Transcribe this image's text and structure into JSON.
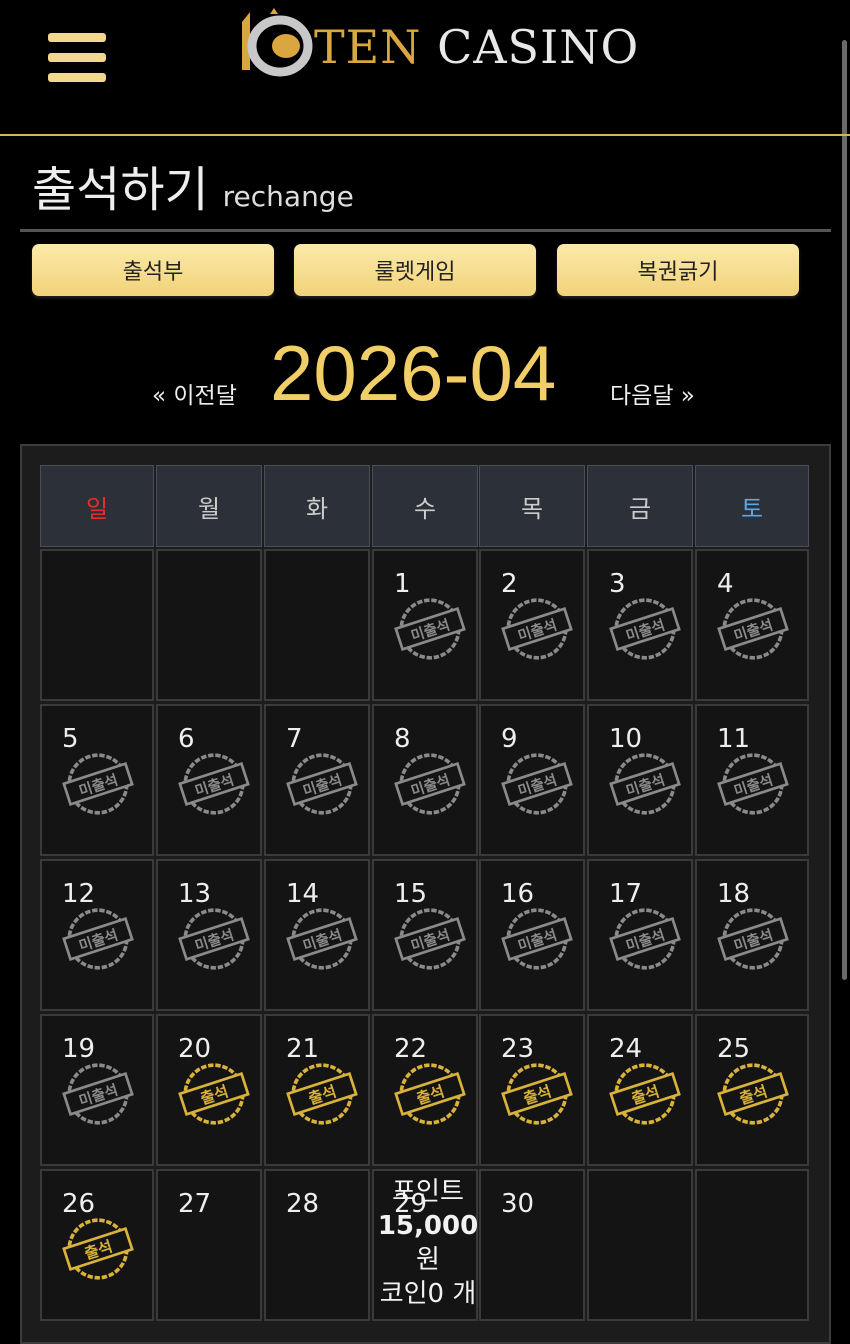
{
  "header": {
    "brand_ten": "TEN",
    "brand_casino": "CASINO",
    "menu_icon": "hamburger-menu-icon",
    "colors": {
      "gold": "#f1ce68",
      "line": "#d9b25a"
    }
  },
  "page": {
    "title": "출석하기",
    "subtitle": "rechange"
  },
  "tabs": [
    {
      "label": "출석부"
    },
    {
      "label": "룰렛게임"
    },
    {
      "label": "복권긁기"
    }
  ],
  "month_nav": {
    "prev_label": "« 이전달",
    "current": "2026-04",
    "next_label": "다음달 »"
  },
  "calendar": {
    "weekdays": [
      "일",
      "월",
      "화",
      "수",
      "목",
      "금",
      "토"
    ],
    "weekday_colors": {
      "sunday": "#e0302c",
      "saturday": "#5aa7ec",
      "default": "#cccccc"
    },
    "stamp_labels": {
      "absent": "미출석",
      "present": "출석"
    },
    "stamp_colors": {
      "absent": "#8a8a8a",
      "present": "#d8b23a"
    },
    "weeks": [
      [
        {},
        {},
        {},
        {
          "day": "1",
          "status": "absent"
        },
        {
          "day": "2",
          "status": "absent"
        },
        {
          "day": "3",
          "status": "absent"
        },
        {
          "day": "4",
          "status": "absent"
        }
      ],
      [
        {
          "day": "5",
          "status": "absent"
        },
        {
          "day": "6",
          "status": "absent"
        },
        {
          "day": "7",
          "status": "absent"
        },
        {
          "day": "8",
          "status": "absent"
        },
        {
          "day": "9",
          "status": "absent"
        },
        {
          "day": "10",
          "status": "absent"
        },
        {
          "day": "11",
          "status": "absent"
        }
      ],
      [
        {
          "day": "12",
          "status": "absent"
        },
        {
          "day": "13",
          "status": "absent"
        },
        {
          "day": "14",
          "status": "absent"
        },
        {
          "day": "15",
          "status": "absent"
        },
        {
          "day": "16",
          "status": "absent"
        },
        {
          "day": "17",
          "status": "absent"
        },
        {
          "day": "18",
          "status": "absent"
        }
      ],
      [
        {
          "day": "19",
          "status": "absent"
        },
        {
          "day": "20",
          "status": "present"
        },
        {
          "day": "21",
          "status": "present"
        },
        {
          "day": "22",
          "status": "present"
        },
        {
          "day": "23",
          "status": "present"
        },
        {
          "day": "24",
          "status": "present"
        },
        {
          "day": "25",
          "status": "present"
        }
      ],
      [
        {
          "day": "26",
          "status": "present"
        },
        {
          "day": "27"
        },
        {
          "day": "28"
        },
        {
          "day": "29",
          "summary": {
            "points_label": "포인트",
            "points_value": "15,000",
            "points_unit": "원",
            "coins": "코인0 개"
          }
        },
        {
          "day": "30"
        },
        {},
        {}
      ]
    ]
  }
}
